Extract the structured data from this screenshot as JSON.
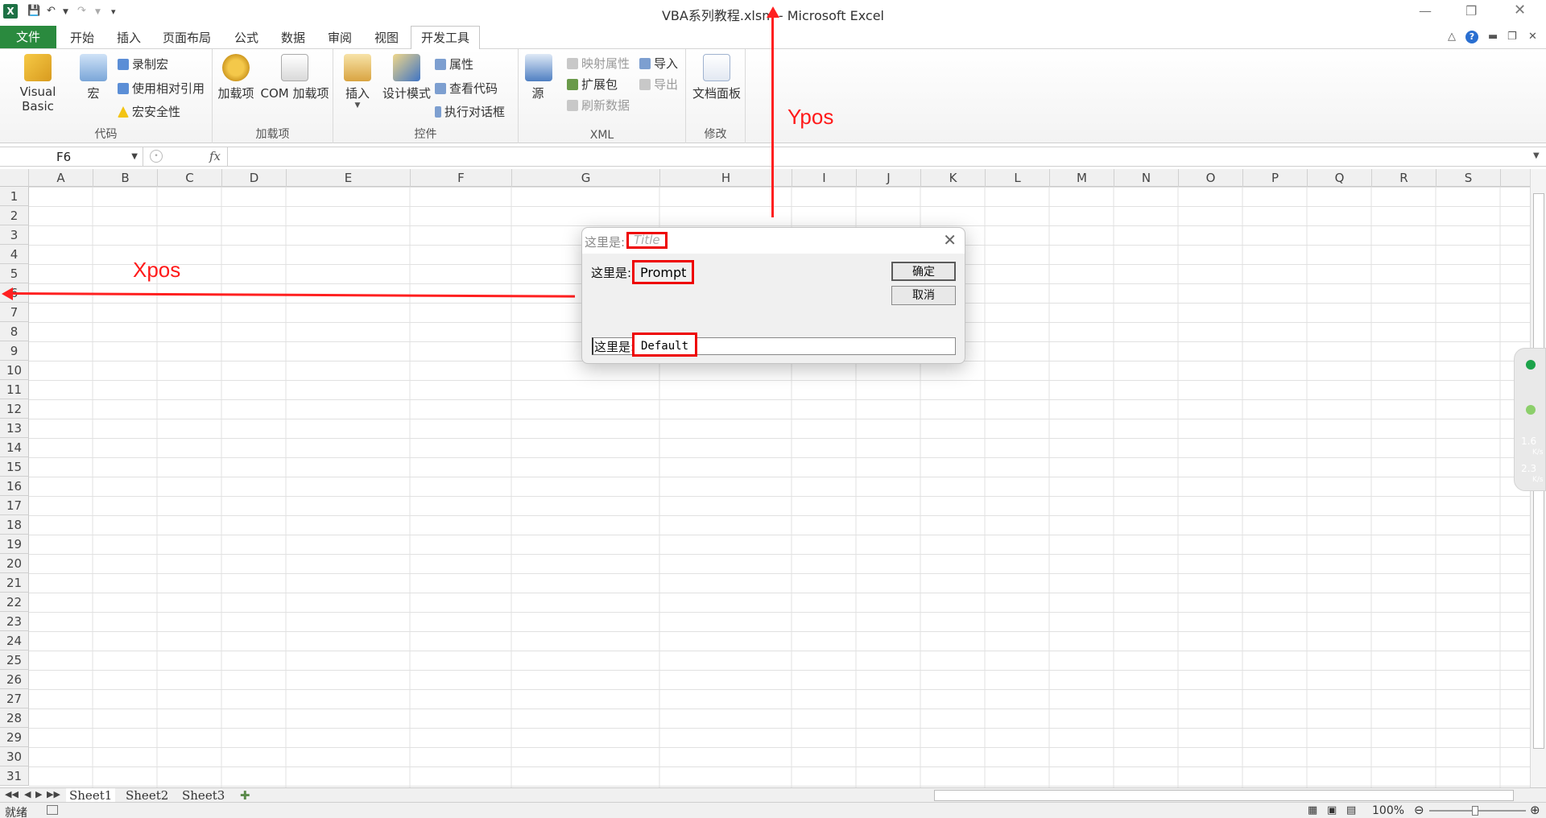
{
  "window": {
    "title": "VBA系列教程.xlsm - Microsoft Excel",
    "app_logo": "X"
  },
  "tabs": [
    {
      "label": "文件"
    },
    {
      "label": "开始"
    },
    {
      "label": "插入"
    },
    {
      "label": "页面布局"
    },
    {
      "label": "公式"
    },
    {
      "label": "数据"
    },
    {
      "label": "审阅"
    },
    {
      "label": "视图"
    },
    {
      "label": "开发工具"
    }
  ],
  "ribbon": {
    "code_group": {
      "label": "代码",
      "visual_basic": "Visual Basic",
      "macro": "宏",
      "record_macro": "录制宏",
      "relative_ref": "使用相对引用",
      "macro_security": "宏安全性"
    },
    "addins_group": {
      "label": "加载项",
      "addins": "加载项",
      "com_addins": "COM 加载项"
    },
    "controls_group": {
      "label": "控件",
      "insert": "插入",
      "design_mode": "设计模式",
      "properties": "属性",
      "view_code": "查看代码",
      "run_dialog": "执行对话框"
    },
    "xml_group": {
      "label": "XML",
      "source": "源",
      "map_props": "映射属性",
      "expansion": "扩展包",
      "refresh": "刷新数据",
      "import": "导入",
      "export": "导出"
    },
    "modify_group": {
      "label": "修改",
      "doc_panel": "文档面板"
    }
  },
  "formula_bar": {
    "name_box": "F6",
    "fx": "fx",
    "formula": ""
  },
  "columns": [
    "A",
    "B",
    "C",
    "D",
    "E",
    "F",
    "G",
    "H",
    "I",
    "J",
    "K",
    "L",
    "M",
    "N",
    "O",
    "P",
    "Q",
    "R",
    "S"
  ],
  "rows": [
    "1",
    "2",
    "3",
    "4",
    "5",
    "6",
    "7",
    "8",
    "9",
    "10",
    "11",
    "12",
    "13",
    "14",
    "15",
    "16",
    "17",
    "18",
    "19",
    "20",
    "21",
    "22",
    "23",
    "24",
    "25",
    "26",
    "27",
    "28",
    "29",
    "30",
    "31"
  ],
  "sheets": [
    "Sheet1",
    "Sheet2",
    "Sheet3"
  ],
  "status": {
    "ready": "就绪",
    "zoom": "100%"
  },
  "side_widget": {
    "upload": "1.6",
    "download": "2.3",
    "unit": "K/s"
  },
  "annotations": {
    "xpos": "Xpos",
    "ypos": "Ypos"
  },
  "dialog": {
    "title_prefix": "这里是:",
    "title_value": "Title",
    "prompt_prefix": "这里是:",
    "prompt_value": "Prompt",
    "ok": "确定",
    "cancel": "取消",
    "input_prefix": "这里是:",
    "default_value": "Default"
  },
  "colors": {
    "file_tab": "#2a8a3e",
    "annotation": "#ff1a1a",
    "highlight_box": "#e00000"
  }
}
